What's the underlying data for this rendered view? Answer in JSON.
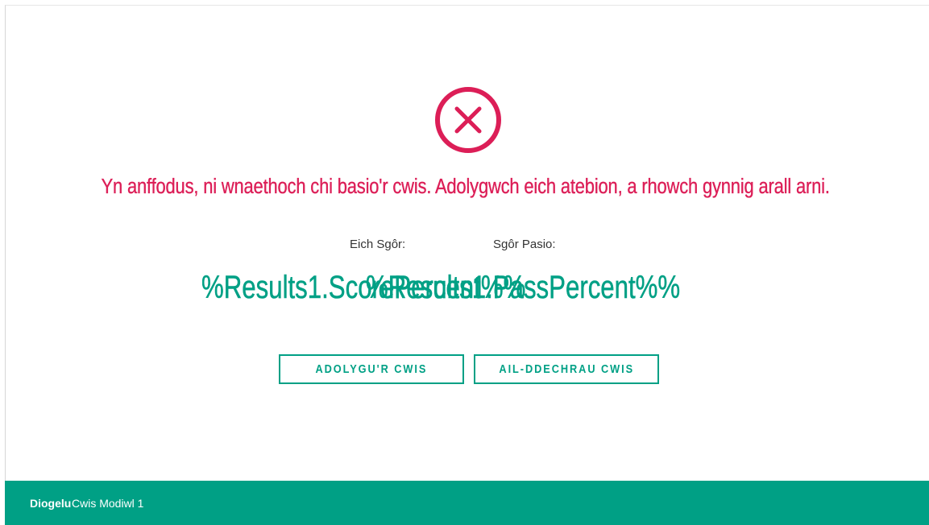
{
  "colors": {
    "accent": "#00a085",
    "error": "#dc1e57",
    "label": "#333333"
  },
  "result": {
    "icon": "close-circle-icon",
    "message": "Yn anffodus, ni wnaethoch chi basio'r cwis. Adolygwch eich atebion, a rhowch gynnig arall arni."
  },
  "scores": {
    "your_score_label": "Eich Sgôr:",
    "pass_score_label": "Sgôr Pasio:",
    "your_score_value": "%Results1.ScorePercent%%",
    "pass_score_value": "%Results1.PassPercent%%"
  },
  "actions": {
    "review_label": "ADOLYGU'R CWIS",
    "restart_label": "AIL-DDECHRAU CWIS"
  },
  "footer": {
    "brand": "Diogelu",
    "title": "Cwis Modiwl 1"
  }
}
